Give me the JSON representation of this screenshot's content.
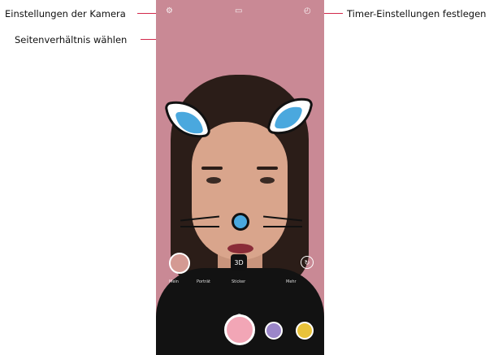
{
  "callouts": {
    "camera_settings": "Einstellungen der Kamera",
    "aspect_ratio": "Seitenverhältnis wählen",
    "timer_settings": "Timer-Einstellungen festlegen"
  },
  "top_icons": {
    "settings": "gear-icon",
    "aspect_ratio": "aspect-ratio-icon",
    "timer": "timer-icon"
  },
  "bottom_modes": [
    "Mein",
    "Porträt",
    "Sticker",
    "Mehr"
  ],
  "mode_button_label": "3D",
  "icons": {
    "switch_camera": "switch-camera-icon",
    "chevron": "chevron-up-icon",
    "shutter": "shutter-button",
    "sticker_purple": "purple-sticker-icon",
    "sticker_yellow": "yellow-sticker-icon"
  },
  "colors": {
    "leader_line": "#d2284b",
    "screen_background": "#c98995",
    "nose_ears": "#4aa8de"
  }
}
